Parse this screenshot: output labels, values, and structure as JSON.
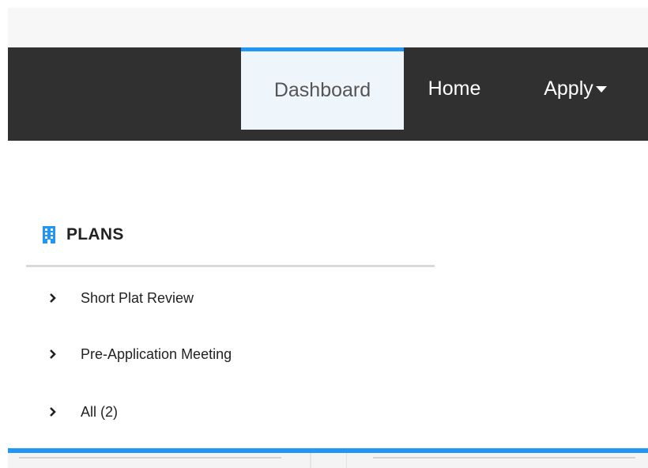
{
  "nav": {
    "items": [
      {
        "label": "Dashboard",
        "active": true
      },
      {
        "label": "Home"
      },
      {
        "label": "Apply",
        "icon": "caret-down-icon"
      }
    ],
    "colors": {
      "bar": "#303030",
      "active_bg": "#eef6fc",
      "accent": "#2196f3"
    }
  },
  "plans": {
    "icon": "building-icon",
    "title": "PLANS",
    "links": [
      {
        "label": "Short Plat Review",
        "icon": "chevron-right-icon"
      },
      {
        "label": "Pre-Application Meeting",
        "icon": "chevron-right-icon"
      },
      {
        "label": "All (2)",
        "icon": "chevron-right-icon"
      }
    ]
  }
}
